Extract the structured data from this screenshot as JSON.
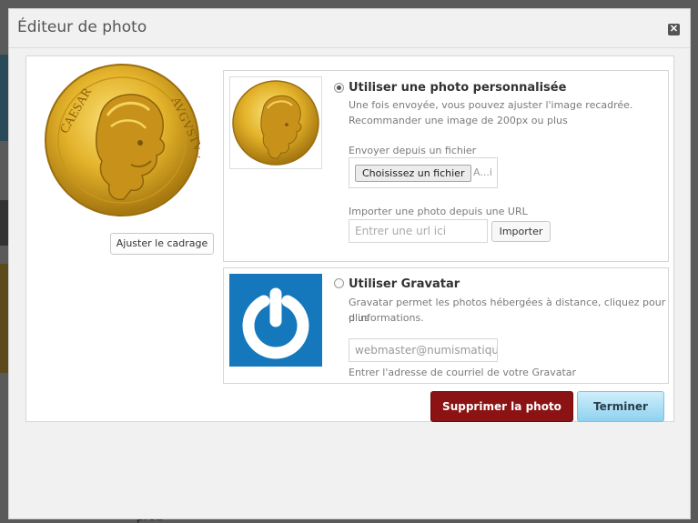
{
  "background": {
    "partial_text": "prou"
  },
  "modal": {
    "title": "Éditeur de photo",
    "close_icon": "close-icon"
  },
  "left": {
    "adjust_label": "Ajuster le cadrage"
  },
  "custom_photo": {
    "title": "Utiliser une photo personnalisée",
    "selected": true,
    "desc_line1": "Une fois envoyée, vous pouvez ajuster l'image recadrée.",
    "desc_line2": "Recommander une image de 200px ou plus",
    "file_label": "Envoyer depuis un fichier",
    "file_button": "Choisissez un fichier",
    "file_name": "A...i",
    "url_label": "Importer une photo depuis une URL",
    "url_placeholder": "Entrer une url ici",
    "import_button": "Importer"
  },
  "gravatar": {
    "title": "Utiliser Gravatar",
    "selected": false,
    "desc_line1": "Gravatar permet les photos hébergées à distance, cliquez pour plus",
    "desc_line2": "d'informations.",
    "email_value": "webmaster@numismatique.c",
    "email_hint": "Entrer l'adresse de courriel de votre Gravatar"
  },
  "actions": {
    "delete_label": "Supprimer la photo",
    "done_label": "Terminer"
  },
  "colors": {
    "delete": "#8b1313",
    "done": "#8fd2f0",
    "gravatar": "#1577bc"
  }
}
